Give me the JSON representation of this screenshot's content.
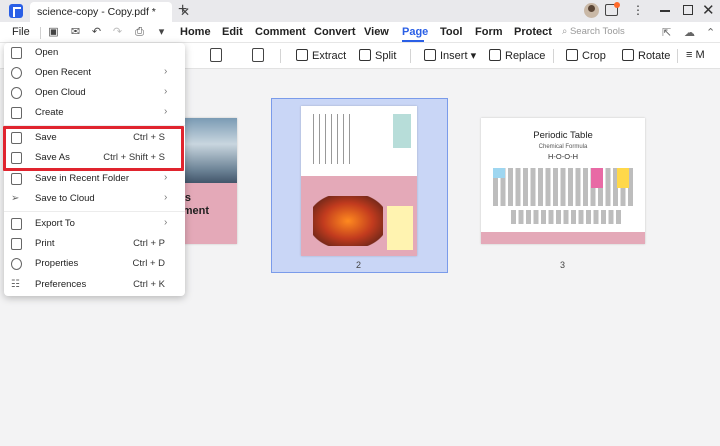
{
  "titlebar": {
    "tab_title": "science-copy - Copy.pdf *",
    "close_glyph": "✕",
    "add_glyph": "+"
  },
  "menubar": {
    "file_label": "File",
    "tabs": [
      "Home",
      "Edit",
      "Comment",
      "Convert",
      "View",
      "Page",
      "Tool",
      "Form",
      "Protect"
    ],
    "active_tab": "Page",
    "search_placeholder": "Search Tools"
  },
  "toolbar": {
    "extract_label": "Extract",
    "split_label": "Split",
    "insert_label": "Insert",
    "replace_label": "Replace",
    "crop_label": "Crop",
    "rotate_label": "Rotate",
    "more_label": "M"
  },
  "file_menu": {
    "items": [
      {
        "label": "Open",
        "shortcut": "",
        "arrow": false
      },
      {
        "label": "Open Recent",
        "shortcut": "",
        "arrow": true
      },
      {
        "label": "Open Cloud",
        "shortcut": "",
        "arrow": true
      },
      {
        "label": "Create",
        "shortcut": "",
        "arrow": true
      },
      {
        "label": "Save",
        "shortcut": "Ctrl + S",
        "arrow": false
      },
      {
        "label": "Save As",
        "shortcut": "Ctrl + Shift + S",
        "arrow": false
      },
      {
        "label": "Save in Recent Folder",
        "shortcut": "",
        "arrow": true
      },
      {
        "label": "Save to Cloud",
        "shortcut": "",
        "arrow": true
      },
      {
        "label": "Export To",
        "shortcut": "",
        "arrow": true
      },
      {
        "label": "Print",
        "shortcut": "Ctrl + P",
        "arrow": false
      },
      {
        "label": "Properties",
        "shortcut": "Ctrl + D",
        "arrow": false
      },
      {
        "label": "Preferences",
        "shortcut": "Ctrl + K",
        "arrow": false
      }
    ]
  },
  "pages": {
    "page1_line1": "s",
    "page1_line2": "ment",
    "page2_number": "2",
    "page3_number": "3",
    "page3_title": "Periodic Table",
    "page3_subtitle": "Chemical Formula",
    "page3_formula": "H-O-O-H"
  },
  "colors": {
    "accent": "#2a5fe6",
    "highlight": "#e0242e",
    "page_pink": "#e4a9b8",
    "selection": "#c9d6f6"
  }
}
